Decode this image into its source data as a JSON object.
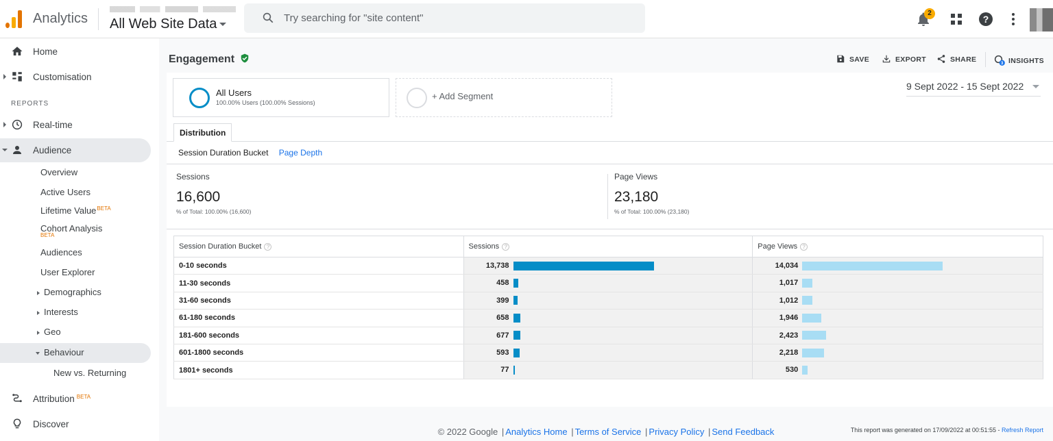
{
  "header": {
    "app_name": "Analytics",
    "property_name": "All Web Site Data",
    "search_placeholder": "Try searching for \"site content\"",
    "notification_count": "2"
  },
  "sidebar": {
    "home": "Home",
    "customisation": "Customisation",
    "reports_label": "REPORTS",
    "realtime": "Real-time",
    "audience": "Audience",
    "audience_items": {
      "overview": "Overview",
      "active_users": "Active Users",
      "lifetime_value": "Lifetime Value",
      "lifetime_beta": "BETA",
      "cohort_analysis": "Cohort Analysis",
      "cohort_beta": "BETA",
      "audiences": "Audiences",
      "user_explorer": "User Explorer",
      "demographics": "Demographics",
      "interests": "Interests",
      "geo": "Geo",
      "behaviour": "Behaviour",
      "new_vs_returning": "New vs. Returning"
    },
    "attribution": "Attribution",
    "attribution_beta": "BETA",
    "discover": "Discover"
  },
  "report": {
    "title": "Engagement",
    "actions": {
      "save": "SAVE",
      "export": "EXPORT",
      "share": "SHARE",
      "insights": "INSIGHTS"
    },
    "segments": {
      "all_users": "All Users",
      "all_users_sub": "100.00% Users (100.00% Sessions)",
      "add_segment": "+ Add Segment"
    },
    "date_range": "9 Sept 2022 - 15 Sept 2022",
    "tab": "Distribution",
    "subtab_current": "Session Duration Bucket",
    "subtab_link": "Page Depth",
    "metrics": {
      "sessions_label": "Sessions",
      "sessions_value": "16,600",
      "sessions_pct": "% of Total: 100.00% (16,600)",
      "pageviews_label": "Page Views",
      "pageviews_value": "23,180",
      "pageviews_pct": "% of Total: 100.00% (23,180)"
    },
    "table": {
      "headers": [
        "Session Duration Bucket",
        "Sessions",
        "Page Views"
      ],
      "rows": [
        {
          "bucket": "0-10 seconds",
          "sessions": "13,738",
          "sessions_n": 13738,
          "pageviews": "14,034",
          "pageviews_n": 14034
        },
        {
          "bucket": "11-30 seconds",
          "sessions": "458",
          "sessions_n": 458,
          "pageviews": "1,017",
          "pageviews_n": 1017
        },
        {
          "bucket": "31-60 seconds",
          "sessions": "399",
          "sessions_n": 399,
          "pageviews": "1,012",
          "pageviews_n": 1012
        },
        {
          "bucket": "61-180 seconds",
          "sessions": "658",
          "sessions_n": 658,
          "pageviews": "1,946",
          "pageviews_n": 1946
        },
        {
          "bucket": "181-600 seconds",
          "sessions": "677",
          "sessions_n": 677,
          "pageviews": "2,423",
          "pageviews_n": 2423
        },
        {
          "bucket": "601-1800 seconds",
          "sessions": "593",
          "sessions_n": 593,
          "pageviews": "2,218",
          "pageviews_n": 2218
        },
        {
          "bucket": "1801+ seconds",
          "sessions": "77",
          "sessions_n": 77,
          "pageviews": "530",
          "pageviews_n": 530
        }
      ]
    },
    "generated_text": "This report was generated on 17/09/2022 at 00:51:55 - ",
    "refresh_link": "Refresh Report"
  },
  "footer": {
    "copyright": "© 2022 Google",
    "links": [
      "Analytics Home",
      "Terms of Service",
      "Privacy Policy",
      "Send Feedback"
    ]
  },
  "colors": {
    "accent_blue": "#058dc7",
    "light_blue": "#a8ddf4",
    "link": "#1a73e8",
    "brand_orange": "#e37400"
  }
}
